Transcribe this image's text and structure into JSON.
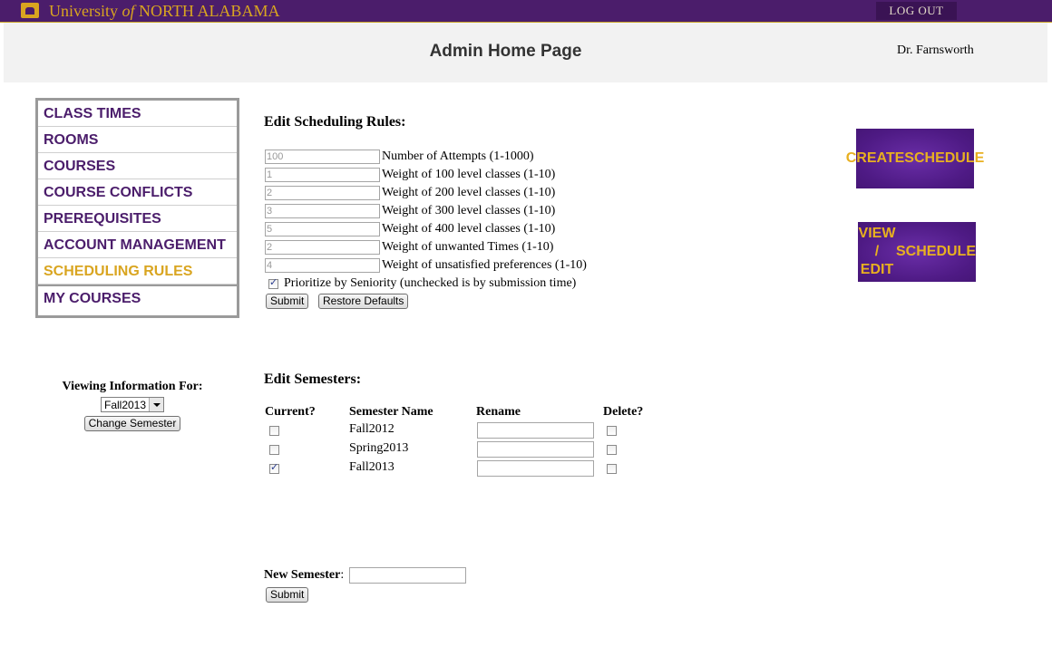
{
  "topbar": {
    "logo_prefix": "University ",
    "logo_of": "of",
    "logo_suffix": " NORTH ALABAMA",
    "logout_label": "LOG OUT",
    "bar_color": "#4b1d6b",
    "accent_color": "#d9a520"
  },
  "header": {
    "title": "Admin Home Page",
    "user": "Dr. Farnsworth"
  },
  "nav": {
    "items": [
      {
        "label": "CLASS TIMES"
      },
      {
        "label": "ROOMS"
      },
      {
        "label": "COURSES"
      },
      {
        "label": "COURSE CONFLICTS"
      },
      {
        "label": "PREREQUISITES"
      },
      {
        "label": "ACCOUNT MANAGEMENT"
      },
      {
        "label": "SCHEDULING RULES",
        "active": true
      },
      {
        "label": "MY COURSES"
      }
    ]
  },
  "viewing": {
    "label": "Viewing Information For:",
    "selected": "Fall2013",
    "button": "Change Semester"
  },
  "rules": {
    "title": "Edit Scheduling Rules:",
    "items": [
      {
        "value": "100",
        "label": "Number of Attempts (1-1000)"
      },
      {
        "value": "1",
        "label": "Weight of 100 level classes (1-10)"
      },
      {
        "value": "2",
        "label": "Weight of 200 level classes (1-10)"
      },
      {
        "value": "3",
        "label": "Weight of 300 level classes (1-10)"
      },
      {
        "value": "5",
        "label": "Weight of 400 level classes (1-10)"
      },
      {
        "value": "2",
        "label": "Weight of unwanted Times (1-10)"
      },
      {
        "value": "4",
        "label": "Weight of unsatisfied preferences (1-10)"
      }
    ],
    "seniority_label": "Prioritize by Seniority (unchecked is by submission time)",
    "seniority_checked": true,
    "submit": "Submit",
    "restore": "Restore Defaults"
  },
  "actions": {
    "create": "CREATE SCHEDULE",
    "view_edit": "VIEW / EDIT SCHEDULE"
  },
  "semesters": {
    "title": "Edit Semesters:",
    "headers": {
      "current": "Current?",
      "name": "Semester Name",
      "rename": "Rename",
      "delete": "Delete?"
    },
    "rows": [
      {
        "name": "Fall2012",
        "current": false
      },
      {
        "name": "Spring2013",
        "current": false
      },
      {
        "name": "Fall2013",
        "current": true
      }
    ],
    "new_label": "New Semester",
    "new_colon": ":",
    "submit": "Submit"
  }
}
